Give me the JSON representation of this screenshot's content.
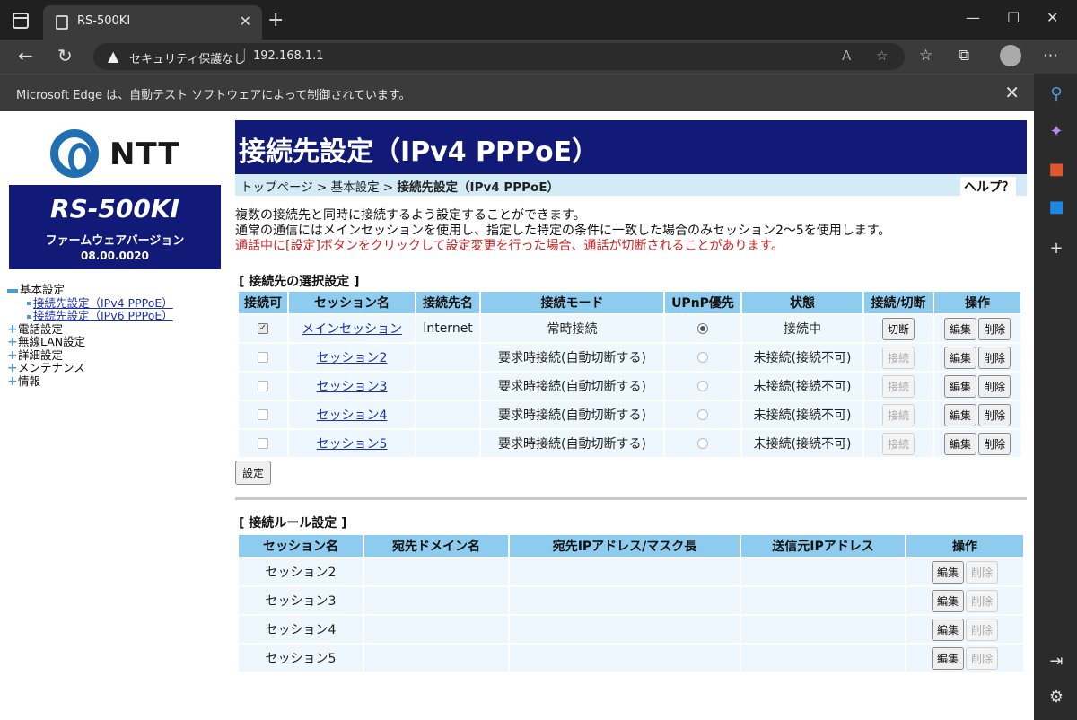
{
  "browser": {
    "tab_title": "RS-500KI",
    "security_label": "セキュリティ保護なし",
    "address": "192.168.1.1",
    "info_message": "Microsoft Edge は、自動テスト ソフトウェアによって制御されています。"
  },
  "sidebar": {
    "logo_text": "NTT",
    "model": "RS-500KI",
    "fw_label": "ファームウェアバージョン",
    "fw_version": "08.00.0020",
    "tree": {
      "basic": "基本設定",
      "ipv4": "接続先設定（IPv4 PPPoE）",
      "ipv6": "接続先設定（IPv6 PPPoE）",
      "phone": "電話設定",
      "wlan": "無線LAN設定",
      "detail": "詳細設定",
      "maint": "メンテナンス",
      "info": "情報"
    }
  },
  "header": {
    "title": "接続先設定（IPv4 PPPoE）",
    "crumb_top": "トップページ",
    "crumb_basic": "基本設定",
    "crumb_current": "接続先設定（IPv4 PPPoE）",
    "crumb_sep": " > ",
    "help": "ヘルプ？"
  },
  "description": {
    "line1": "複数の接続先と同時に接続するよう設定することができます。",
    "line2": "通常の通信にはメインセッションを使用し、指定した特定の条件に一致した場合のみセッション2〜5を使用します。",
    "warning": "通話中に[設定]ボタンをクリックして設定変更を行った場合、通話が切断されることがあります。"
  },
  "sessions": {
    "title": "[ 接続先の選択設定 ]",
    "headers": [
      "接続可",
      "セッション名",
      "接続先名",
      "接続モード",
      "UPnP優先",
      "状態",
      "接続/切断",
      "操作"
    ],
    "rows": [
      {
        "name": "メインセッション",
        "dest": "Internet",
        "mode": "常時接続",
        "status": "接続中",
        "conn_btn": "切断",
        "enabled": true
      },
      {
        "name": "セッション2",
        "dest": "",
        "mode": "要求時接続(自動切断する)",
        "status": "未接続(接続不可)",
        "conn_btn": "接続",
        "enabled": false
      },
      {
        "name": "セッション3",
        "dest": "",
        "mode": "要求時接続(自動切断する)",
        "status": "未接続(接続不可)",
        "conn_btn": "接続",
        "enabled": false
      },
      {
        "name": "セッション4",
        "dest": "",
        "mode": "要求時接続(自動切断する)",
        "status": "未接続(接続不可)",
        "conn_btn": "接続",
        "enabled": false
      },
      {
        "name": "セッション5",
        "dest": "",
        "mode": "要求時接続(自動切断する)",
        "status": "未接続(接続不可)",
        "conn_btn": "接続",
        "enabled": false
      }
    ],
    "edit_label": "編集",
    "delete_label": "削除",
    "set_button": "設定"
  },
  "rules": {
    "title": "[ 接続ルール設定 ]",
    "headers": [
      "セッション名",
      "宛先ドメイン名",
      "宛先IPアドレス/マスク長",
      "送信元IPアドレス",
      "操作"
    ],
    "rows": [
      {
        "name": "セッション2"
      },
      {
        "name": "セッション3"
      },
      {
        "name": "セッション4"
      },
      {
        "name": "セッション5"
      }
    ],
    "edit_label": "編集",
    "delete_label": "削除"
  }
}
